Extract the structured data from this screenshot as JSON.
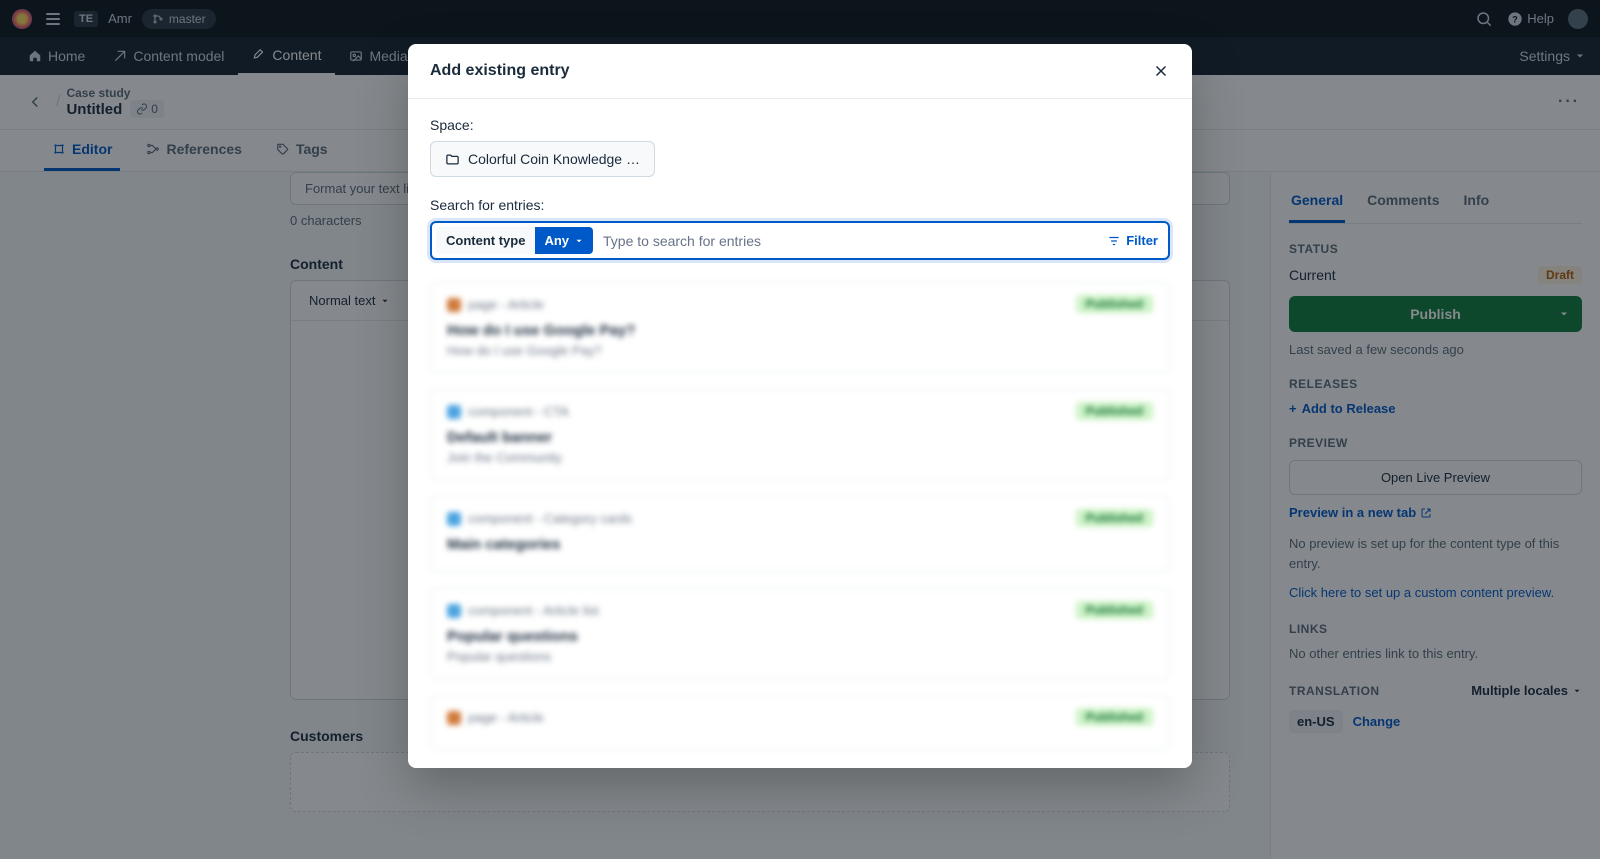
{
  "topbar": {
    "org_badge": "TE",
    "user": "Amr",
    "branch": "master",
    "help": "Help"
  },
  "secondnav": {
    "home": "Home",
    "content_model": "Content model",
    "content": "Content",
    "media": "Media",
    "settings": "Settings"
  },
  "entry": {
    "content_type": "Case study",
    "title": "Untitled",
    "link_count": "0"
  },
  "tabs": {
    "editor": "Editor",
    "references": "References",
    "tags": "Tags"
  },
  "editor": {
    "format_hint": "Format your text like",
    "char_count": "0 characters",
    "content_label": "Content",
    "normal_text": "Normal text",
    "customers_label": "Customers"
  },
  "right": {
    "tabs": {
      "general": "General",
      "comments": "Comments",
      "info": "Info"
    },
    "status_label": "STATUS",
    "current_label": "Current",
    "draft": "Draft",
    "publish": "Publish",
    "last_saved": "Last saved a few seconds ago",
    "releases_label": "RELEASES",
    "add_release": "Add to Release",
    "preview_label": "PREVIEW",
    "open_live_preview": "Open Live Preview",
    "preview_new_tab": "Preview in a new tab",
    "preview_note": "No preview is set up for the content type of this entry.",
    "setup_link": "Click here to set up a custom content preview.",
    "links_label": "LINKS",
    "links_note": "No other entries link to this entry.",
    "translation_label": "TRANSLATION",
    "multiple_locales": "Multiple locales",
    "locale": "en-US",
    "change": "Change"
  },
  "modal": {
    "title": "Add existing entry",
    "space_label": "Space:",
    "space_name": "Colorful Coin Knowledge …",
    "search_label": "Search for entries:",
    "ct_label": "Content type",
    "ct_value": "Any",
    "placeholder": "Type to search for entries",
    "filter": "Filter",
    "results": [
      {
        "icon": "orange",
        "type": "page - Article",
        "title": "How do I use Google Pay?",
        "sub": "How do I use Google Pay?",
        "status": "Published"
      },
      {
        "icon": "blue",
        "type": "component - CTA",
        "title": "Default banner",
        "sub": "Join the Community",
        "status": "Published"
      },
      {
        "icon": "blue",
        "type": "component - Category cards",
        "title": "Main categories",
        "sub": "",
        "status": "Published"
      },
      {
        "icon": "blue",
        "type": "component - Article list",
        "title": "Popular questions",
        "sub": "Popular questions",
        "status": "Published"
      },
      {
        "icon": "orange",
        "type": "page - Article",
        "title": "",
        "sub": "",
        "status": "Published"
      }
    ]
  }
}
